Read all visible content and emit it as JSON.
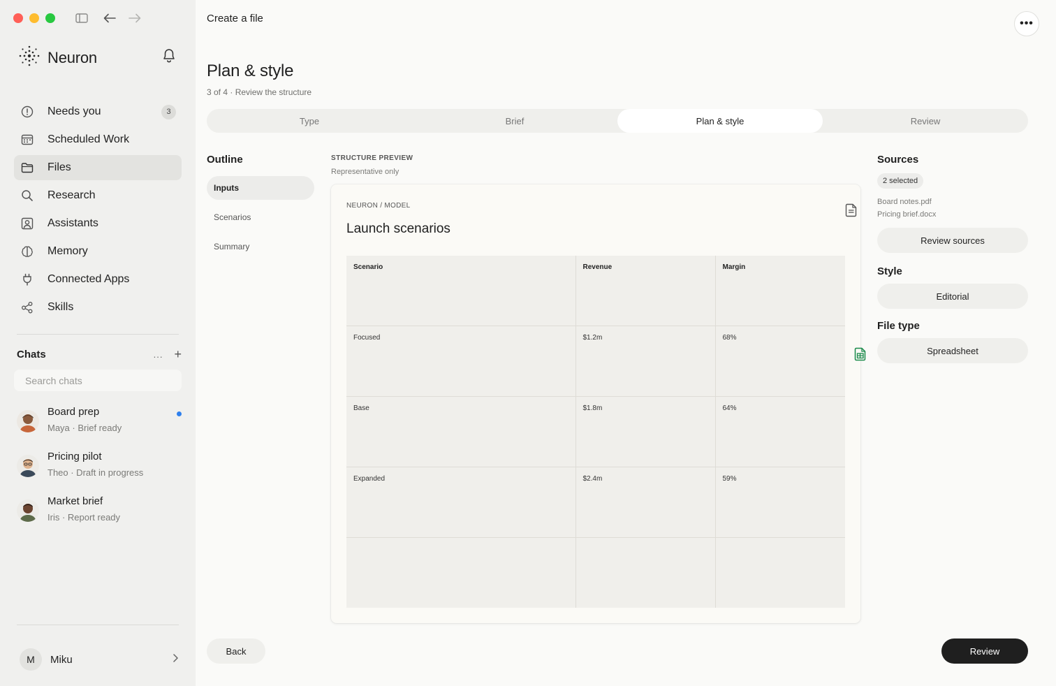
{
  "window": {
    "traffic_colors": [
      "#ff5f57",
      "#febc2e",
      "#28c840"
    ]
  },
  "brand": {
    "name": "Neuron"
  },
  "nav": {
    "items": [
      {
        "label": "Needs you",
        "icon": "alert-circle-icon",
        "badge": "3"
      },
      {
        "label": "Scheduled Work",
        "icon": "calendar-icon"
      },
      {
        "label": "Files",
        "icon": "folder-icon",
        "active": true
      },
      {
        "label": "Research",
        "icon": "search-icon"
      },
      {
        "label": "Assistants",
        "icon": "assistant-icon"
      },
      {
        "label": "Memory",
        "icon": "brain-icon"
      },
      {
        "label": "Connected Apps",
        "icon": "plug-icon"
      },
      {
        "label": "Skills",
        "icon": "share-nodes-icon"
      }
    ]
  },
  "chats": {
    "title": "Chats",
    "more": "...",
    "add": "+",
    "search_placeholder": "Search chats",
    "items": [
      {
        "name": "Board prep",
        "sub": "Maya · Brief ready",
        "unread": true
      },
      {
        "name": "Pricing pilot",
        "sub": "Theo · Draft in progress"
      },
      {
        "name": "Market brief",
        "sub": "Iris · Report ready"
      }
    ]
  },
  "user": {
    "initial": "M",
    "name": "Miku"
  },
  "header": {
    "title": "Create a file",
    "more": "•••"
  },
  "page": {
    "title": "Plan & style",
    "subtitle": "3 of 4 · Review the structure"
  },
  "steps": [
    {
      "label": "Type"
    },
    {
      "label": "Brief"
    },
    {
      "label": "Plan & style",
      "active": true
    },
    {
      "label": "Review"
    }
  ],
  "outline": {
    "title": "Outline",
    "items": [
      {
        "label": "Inputs",
        "active": true
      },
      {
        "label": "Scenarios"
      },
      {
        "label": "Summary"
      }
    ]
  },
  "preview": {
    "label": "STRUCTURE PREVIEW",
    "sub": "Representative only",
    "kicker": "NEURON / MODEL",
    "title": "Launch scenarios",
    "table": {
      "headers": [
        "Scenario",
        "Revenue",
        "Margin"
      ],
      "rows": [
        [
          "Focused",
          "$1.2m",
          "68%"
        ],
        [
          "Base",
          "$1.8m",
          "64%"
        ],
        [
          "Expanded",
          "$2.4m",
          "59%"
        ],
        [
          "",
          "",
          ""
        ]
      ]
    }
  },
  "sources": {
    "title": "Sources",
    "selected": "2 selected",
    "files": [
      "Board notes.pdf",
      "Pricing brief.docx"
    ],
    "review_label": "Review sources"
  },
  "style": {
    "title": "Style",
    "value": "Editorial"
  },
  "file_type": {
    "title": "File type",
    "value": "Spreadsheet"
  },
  "footer": {
    "back_label": "Back",
    "review_label": "Review"
  }
}
